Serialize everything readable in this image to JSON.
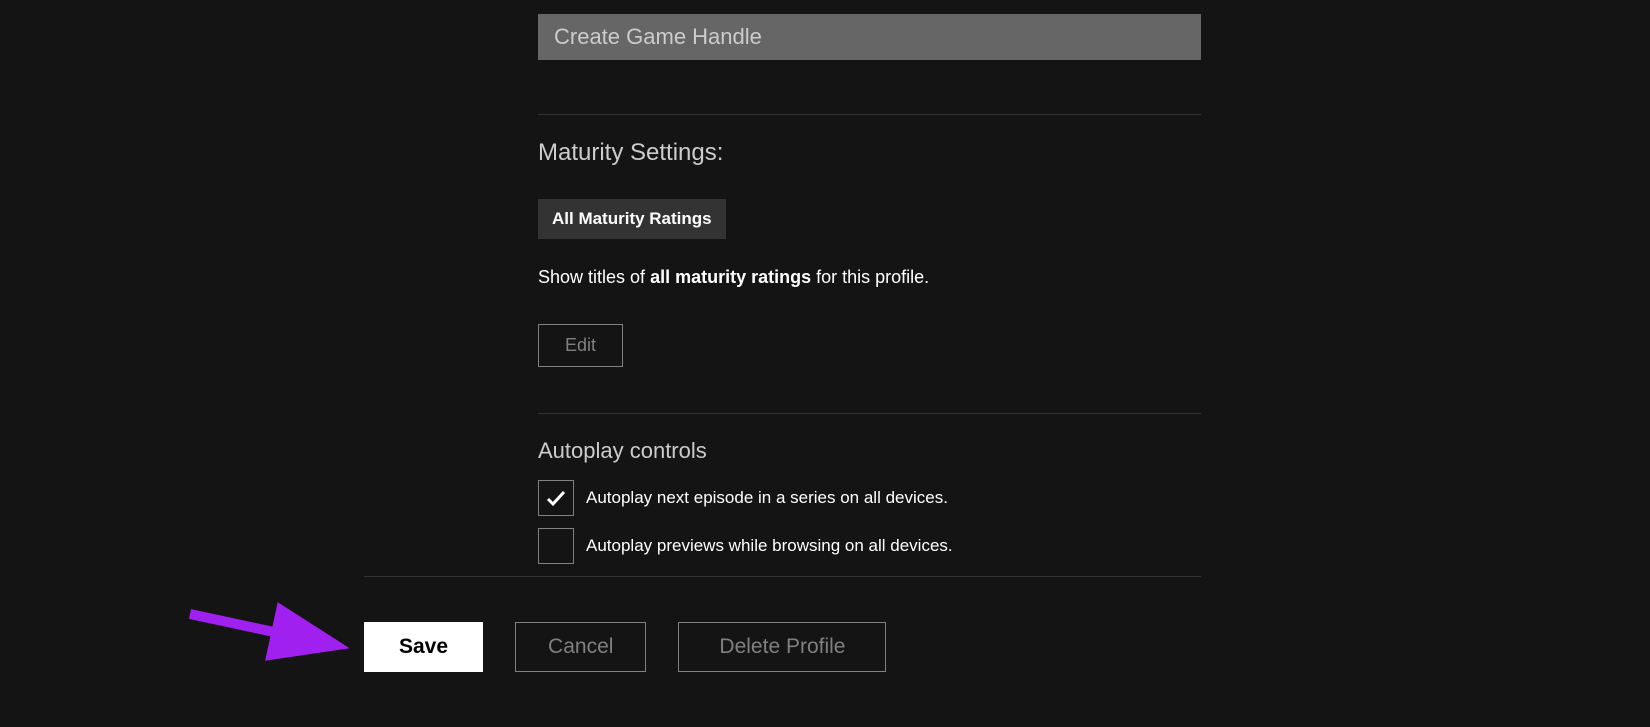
{
  "gameHandle": {
    "placeholder": "Create Game Handle",
    "value": ""
  },
  "maturity": {
    "heading": "Maturity Settings:",
    "badge": "All Maturity Ratings",
    "desc_prefix": "Show titles of ",
    "desc_bold": "all maturity ratings",
    "desc_suffix": " for this profile.",
    "editLabel": "Edit"
  },
  "autoplay": {
    "heading": "Autoplay controls",
    "option1": {
      "label": "Autoplay next episode in a series on all devices.",
      "checked": true
    },
    "option2": {
      "label": "Autoplay previews while browsing on all devices.",
      "checked": false
    }
  },
  "buttons": {
    "save": "Save",
    "cancel": "Cancel",
    "delete": "Delete Profile"
  },
  "annotation": {
    "arrow_color": "#a020f0"
  }
}
